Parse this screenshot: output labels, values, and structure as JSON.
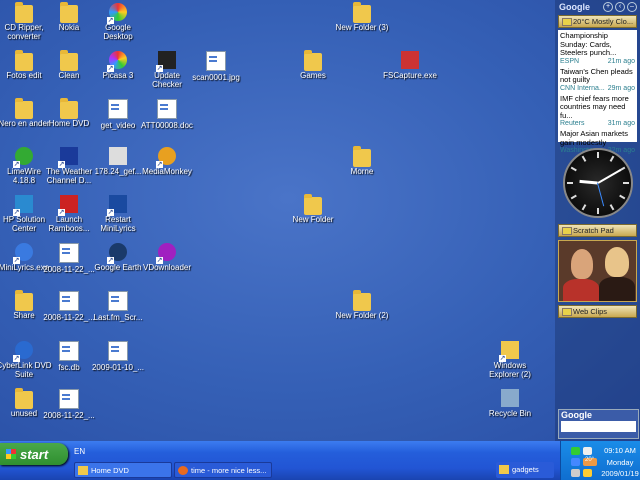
{
  "desktop_icons": [
    {
      "label": "CD Ripper, converter",
      "type": "folder",
      "shortcut": false
    },
    {
      "label": "Nokia",
      "type": "folder",
      "shortcut": false
    },
    {
      "label": "Google Desktop",
      "type": "google-desktop",
      "shortcut": true
    },
    {
      "label": "New Folder (3)",
      "type": "folder",
      "shortcut": false
    },
    {
      "label": "Fotos edit",
      "type": "folder",
      "shortcut": false
    },
    {
      "label": "Clean",
      "type": "folder",
      "shortcut": false
    },
    {
      "label": "Picasa 3",
      "type": "picasa",
      "shortcut": true
    },
    {
      "label": "Update Checker",
      "type": "update-checker",
      "shortcut": true
    },
    {
      "label": "scan0001.jpg",
      "type": "image",
      "shortcut": false
    },
    {
      "label": "Games",
      "type": "folder",
      "shortcut": false
    },
    {
      "label": "FSCapture.exe",
      "type": "fscapture",
      "shortcut": false
    },
    {
      "label": "Nero en ander",
      "type": "folder",
      "shortcut": false
    },
    {
      "label": "Home DVD",
      "type": "folder",
      "shortcut": false
    },
    {
      "label": "get_video",
      "type": "doc",
      "shortcut": false
    },
    {
      "label": "ATT00008.doc",
      "type": "word",
      "shortcut": false
    },
    {
      "label": "LimeWire 4.18.8",
      "type": "limewire",
      "shortcut": true
    },
    {
      "label": "The Weather Channel D...",
      "type": "weather",
      "shortcut": true
    },
    {
      "label": "178.24_gef...",
      "type": "installer",
      "shortcut": false
    },
    {
      "label": "MediaMonkey",
      "type": "mediamonkey",
      "shortcut": true
    },
    {
      "label": "Morne",
      "type": "folder",
      "shortcut": false
    },
    {
      "label": "New Folder",
      "type": "folder",
      "shortcut": false
    },
    {
      "label": "HP Solution Center",
      "type": "hp",
      "shortcut": true
    },
    {
      "label": "Launch Ramboos...",
      "type": "ramboos",
      "shortcut": true
    },
    {
      "label": "Restart MiniLyrics",
      "type": "minilyrics",
      "shortcut": true
    },
    {
      "label": "MiniLyrics.exe",
      "type": "minilyrics-exe",
      "shortcut": true
    },
    {
      "label": "2008-11-22_...",
      "type": "image",
      "shortcut": false
    },
    {
      "label": "Google Earth",
      "type": "google-earth",
      "shortcut": true
    },
    {
      "label": "VDownloader",
      "type": "vdownloader",
      "shortcut": true
    },
    {
      "label": "Share",
      "type": "folder",
      "shortcut": false
    },
    {
      "label": "2008-11-22_...",
      "type": "image",
      "shortcut": false
    },
    {
      "label": "Last.fm_Scr...",
      "type": "music",
      "shortcut": false
    },
    {
      "label": "New Folder (2)",
      "type": "folder",
      "shortcut": false
    },
    {
      "label": "CyberLink DVD Suite",
      "type": "cyberlink",
      "shortcut": true
    },
    {
      "label": "fsc.db",
      "type": "image",
      "shortcut": false
    },
    {
      "label": "2009-01-10_...",
      "type": "image",
      "shortcut": false
    },
    {
      "label": "Windows Explorer (2)",
      "type": "explorer",
      "shortcut": true
    },
    {
      "label": "unused",
      "type": "folder",
      "shortcut": false
    },
    {
      "label": "2008-11-22_...",
      "type": "image",
      "shortcut": false
    },
    {
      "label": "Recycle Bin",
      "type": "recycle-bin",
      "shortcut": false
    }
  ],
  "sidebar": {
    "logo": "Google",
    "buttons": [
      "+",
      "‹",
      "–"
    ],
    "weather": "20°C Mostly Clo...",
    "news": [
      {
        "headline": "Championship Sunday: Cards, Steelers punch...",
        "source": "ESPN",
        "age": "21m ago"
      },
      {
        "headline": "Taiwan's Chen pleads not guilty",
        "source": "CNN Interna...",
        "age": "29m ago"
      },
      {
        "headline": "IMF chief fears more countries may need fu...",
        "source": "Reuters",
        "age": "31m ago"
      },
      {
        "headline": "Major Asian markets gain modestly",
        "source": "Washington ...",
        "age": "32m ago"
      }
    ],
    "clock": {
      "hour": 9,
      "minute": 10
    },
    "scratch_pad": "Scratch Pad",
    "web_clips": "Web Clips",
    "search_logo": "Google"
  },
  "taskbar": {
    "start": "start",
    "lang": "EN",
    "tasks": [
      {
        "label": "Home DVD",
        "icon": "folder-icon"
      },
      {
        "label": "time - more nice less...",
        "icon": "firefox-icon"
      },
      {
        "label": "gadgets",
        "icon": "folder-icon"
      }
    ],
    "time": "09:10 AM",
    "day": "Monday",
    "date": "2009/01/19",
    "tray_temp": "20°"
  },
  "colors": {
    "desktop": "#3a62b6",
    "taskbar": "#245edb",
    "start": "#3a9a3a",
    "folder": "#f0c84c"
  }
}
